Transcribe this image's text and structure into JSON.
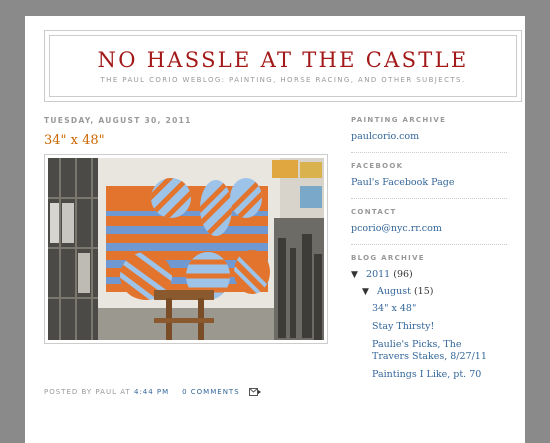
{
  "header": {
    "title": "NO HASSLE AT THE CASTLE",
    "description": "THE PAUL CORIO WEBLOG: PAINTING, HORSE RACING, AND OTHER SUBJECTS."
  },
  "post": {
    "date": "TUESDAY, AUGUST 30, 2011",
    "title": "34\" x 48\"",
    "footer": {
      "posted_by": "POSTED BY PAUL AT",
      "time": "4:44 PM",
      "comments": "0 COMMENTS"
    }
  },
  "sidebar": {
    "painting_archive": {
      "heading": "PAINTING ARCHIVE",
      "link": "paulcorio.com"
    },
    "facebook": {
      "heading": "FACEBOOK",
      "link": "Paul's Facebook Page"
    },
    "contact": {
      "heading": "CONTACT",
      "link": "pcorio@nyc.rr.com"
    },
    "blog_archive": {
      "heading": "BLOG ARCHIVE",
      "year": {
        "label": "2011",
        "count": "(96)"
      },
      "month": {
        "label": "August",
        "count": "(15)"
      },
      "posts": [
        "34\" x 48\"",
        "Stay Thirsty!",
        "Paulie's Picks, The Travers Stakes, 8/27/11",
        "Paintings I Like, pt. 70"
      ]
    }
  },
  "colors": {
    "title": "#a31919",
    "post_title": "#cc6600",
    "link": "#336699",
    "meta": "#999999"
  },
  "icons": [
    "email-post-icon",
    "collapse-triangle-icon"
  ]
}
